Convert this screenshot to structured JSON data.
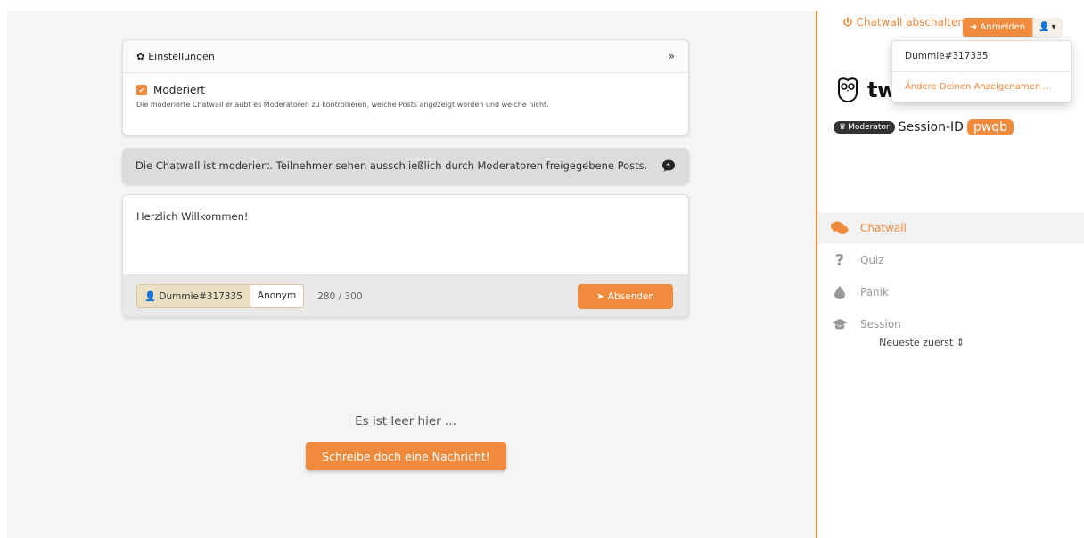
{
  "header": {
    "chatwall_off_label": "Chatwall abschalten"
  },
  "settings": {
    "title": "Einstellungen",
    "moderated_label": "Moderiert",
    "moderated_checked": true,
    "description": "Die moderierte Chatwall erlaubt es Moderatoren zu kontrollieren, welche Posts angezeigt werden und welche nicht."
  },
  "notice": {
    "text": "Die Chatwall ist moderiert. Teilnehmer sehen ausschließlich durch Moderatoren freigegebene Posts."
  },
  "composer": {
    "text": "Herzlich Willkommen!",
    "name_option": "Dummie#317335",
    "anon_option": "Anonym",
    "counter": "280 / 300",
    "send_label": "Absenden"
  },
  "feed": {
    "sort_label": "Neueste zuerst",
    "empty_title": "Es ist leer hier ...",
    "write_button": "Schreibe doch eine Nachricht!"
  },
  "sidebar": {
    "login_label": "Anmelden",
    "logo_text": "tweedback",
    "moderator_badge": "Moderator",
    "session_label": "Session-ID",
    "session_code": "pwqb",
    "dropdown": {
      "username": "Dummie#317335",
      "change_name": "Ändere Deinen Anzeigenamen ..."
    },
    "nav": [
      {
        "label": "Chatwall",
        "icon": "chat-icon",
        "active": true
      },
      {
        "label": "Quiz",
        "icon": "question-icon",
        "active": false
      },
      {
        "label": "Panik",
        "icon": "drop-icon",
        "active": false
      },
      {
        "label": "Session",
        "icon": "graduation-cap-icon",
        "active": false
      }
    ]
  },
  "colors": {
    "accent": "#f08a3c",
    "notice_bg": "#dcdcdc"
  }
}
